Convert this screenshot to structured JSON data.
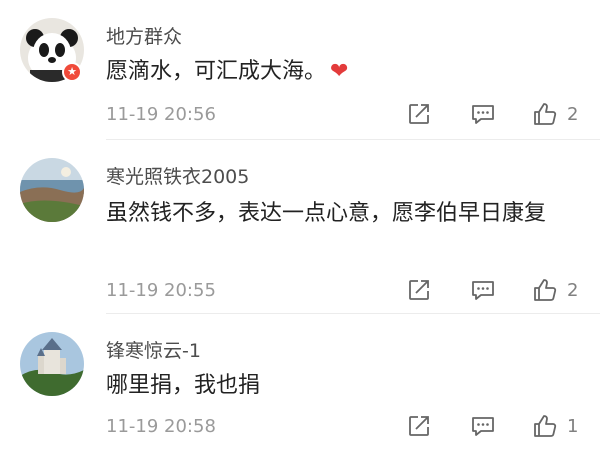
{
  "comments": [
    {
      "username": "地方群众",
      "text": "愿滴水，可汇成大海。",
      "emoji": "heart",
      "time": "11-19 20:56",
      "likes": "2",
      "avatar": "panda-avatar",
      "badge_icon": "star-badge-icon"
    },
    {
      "username": "寒光照铁衣2005",
      "text": "虽然钱不多，表达一点心意，愿李伯早日康复",
      "time": "11-19 20:55",
      "likes": "2",
      "avatar": "coast-landscape-avatar"
    },
    {
      "username": "锋寒惊云-1",
      "text": "哪里捐，我也捐",
      "time": "11-19 20:58",
      "likes": "1",
      "avatar": "castle-landscape-avatar"
    }
  ],
  "colors": {
    "text": "#222222",
    "username": "#4d4d4d",
    "meta": "#9a9a9a",
    "heart": "#e33b3b",
    "badge": "#f04a3a",
    "divider": "#ececec"
  },
  "icons": [
    "repost-icon",
    "comment-icon",
    "like-icon"
  ]
}
